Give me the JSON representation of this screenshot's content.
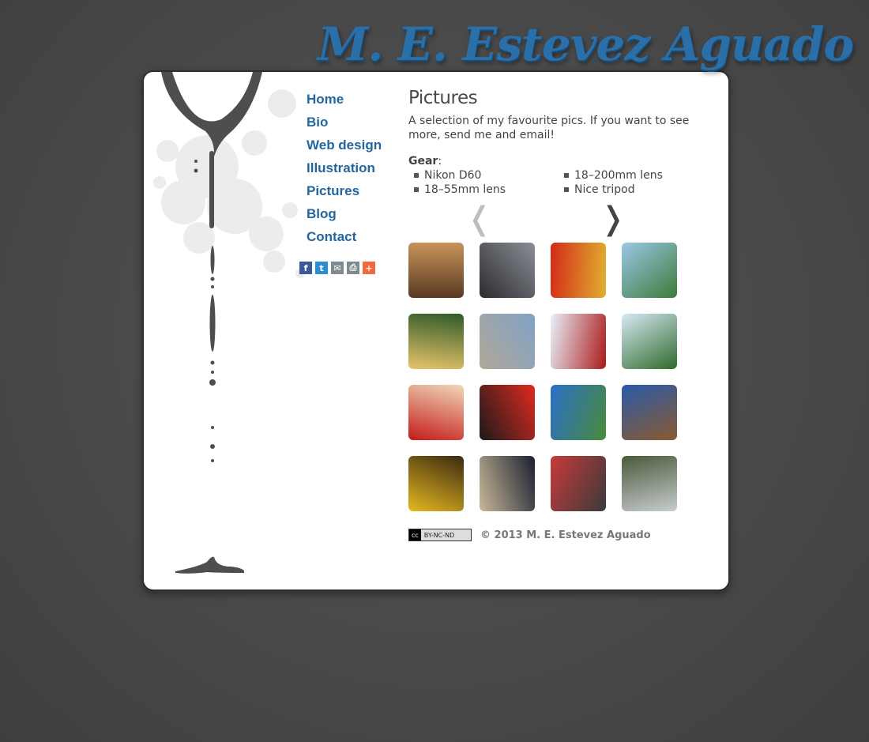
{
  "site": {
    "title": "M. E. Estevez Aguado"
  },
  "nav": {
    "items": [
      "Home",
      "Bio",
      "Web design",
      "Illustration",
      "Pictures",
      "Blog",
      "Contact"
    ]
  },
  "share": [
    {
      "icon": "facebook-icon",
      "glyph": "f",
      "color": "#3b5998"
    },
    {
      "icon": "twitter-icon",
      "glyph": "t",
      "color": "#2b8ed2"
    },
    {
      "icon": "email-icon",
      "glyph": "✉",
      "color": "#7d8b91"
    },
    {
      "icon": "print-icon",
      "glyph": "⎙",
      "color": "#7d8b91"
    },
    {
      "icon": "add-icon",
      "glyph": "+",
      "color": "#f26a3c"
    }
  ],
  "page": {
    "title": "Pictures",
    "intro": "A selection of my favourite pics. If you want to see more, send me and email!",
    "gear_label": "Gear",
    "gear_colon": ":",
    "gear": [
      "Nikon D60",
      "18–200mm lens",
      "18–55mm lens",
      "Nice tripod"
    ],
    "prev_arrow": "❬",
    "next_arrow": "❭"
  },
  "thumbnails": [
    {
      "c1": "#5a3a22",
      "c2": "#c8925a"
    },
    {
      "c1": "#2c2c30",
      "c2": "#8a8e96"
    },
    {
      "c1": "#d42a18",
      "c2": "#e0b030"
    },
    {
      "c1": "#9cc7e6",
      "c2": "#3d7a3a"
    },
    {
      "c1": "#2f5a2a",
      "c2": "#e8c46a"
    },
    {
      "c1": "#7fa2c6",
      "c2": "#b2a898"
    },
    {
      "c1": "#aa1a1a",
      "c2": "#e8f0f8"
    },
    {
      "c1": "#2e6a2a",
      "c2": "#d6e8f6"
    },
    {
      "c1": "#c41a1a",
      "c2": "#f0d8b8"
    },
    {
      "c1": "#1a1a1a",
      "c2": "#e02a20"
    },
    {
      "c1": "#2a6fc8",
      "c2": "#4a8a3a"
    },
    {
      "c1": "#2a5aa8",
      "c2": "#8a5a30"
    },
    {
      "c1": "#3a2a10",
      "c2": "#e6b820"
    },
    {
      "c1": "#1a2030",
      "c2": "#c8b898"
    },
    {
      "c1": "#3a3a3a",
      "c2": "#c83a3a"
    },
    {
      "c1": "#c8cccf",
      "c2": "#4a5a3a"
    }
  ],
  "footer": {
    "license_left": "cc",
    "license_right": "BY-NC-ND",
    "copyright": "© 2013 M. E. Estevez Aguado"
  }
}
